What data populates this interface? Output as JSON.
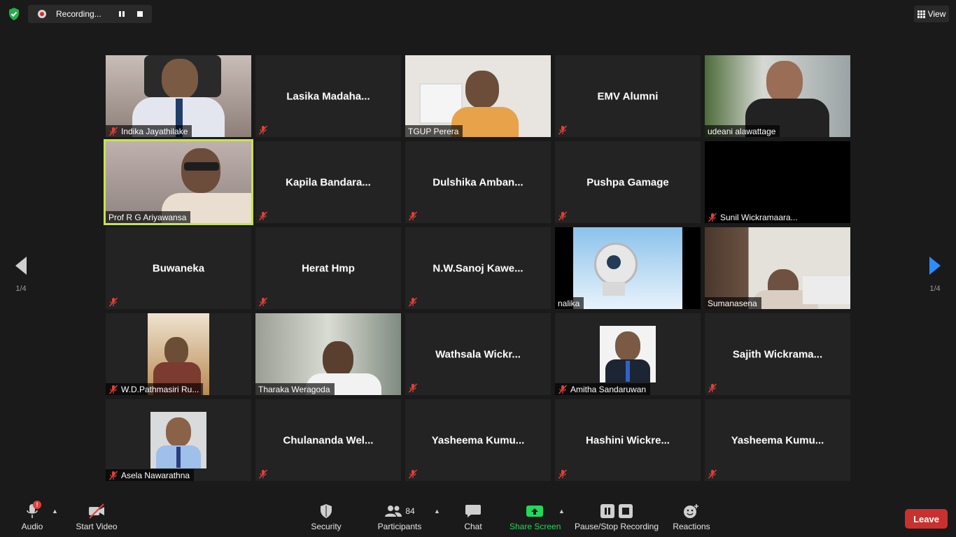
{
  "top": {
    "recording_label": "Recording...",
    "view_label": "View"
  },
  "pages": {
    "left": "1/4",
    "right": "1/4"
  },
  "tiles": [
    {
      "name": "Indika Jayathilake",
      "video": true
    },
    {
      "name": "Lasika  Madaha...",
      "video": false
    },
    {
      "name": "TGUP Perera",
      "video": true
    },
    {
      "name": "EMV Alumni",
      "video": false
    },
    {
      "name": "udeani alawattage",
      "video": true
    },
    {
      "name": "Prof R G Ariyawansa",
      "video": true,
      "active": true
    },
    {
      "name": "Kapila  Bandara...",
      "video": false
    },
    {
      "name": "Dulshika  Amban...",
      "video": false
    },
    {
      "name": "Pushpa Gamage",
      "video": false
    },
    {
      "name": "Sunil Wickramaara...",
      "video": true
    },
    {
      "name": "Buwaneka",
      "video": false
    },
    {
      "name": "Herat Hmp",
      "video": false
    },
    {
      "name": "N.W.Sanoj  Kawe...",
      "video": false
    },
    {
      "name": "nalika",
      "video": true
    },
    {
      "name": "Sumanasena",
      "video": true
    },
    {
      "name": "W.D.Pathmasiri Ru...",
      "video": true
    },
    {
      "name": "Tharaka Weragoda",
      "video": true
    },
    {
      "name": "Wathsala  Wickr...",
      "video": false
    },
    {
      "name": "Amitha Sandaruwan",
      "video": true
    },
    {
      "name": "Sajith  Wickrama...",
      "video": false
    },
    {
      "name": "Asela Nawarathna",
      "video": true
    },
    {
      "name": "Chulananda  Wel...",
      "video": false
    },
    {
      "name": "Yasheema  Kumu...",
      "video": false
    },
    {
      "name": "Hashini  Wickre...",
      "video": false
    },
    {
      "name": "Yasheema  Kumu...",
      "video": false
    }
  ],
  "toolbar": {
    "audio": "Audio",
    "audio_badge": "!",
    "start_video": "Start Video",
    "security": "Security",
    "participants": "Participants",
    "participants_count": "84",
    "chat": "Chat",
    "share_screen": "Share Screen",
    "pause_stop": "Pause/Stop Recording",
    "reactions": "Reactions",
    "leave": "Leave"
  },
  "colors": {
    "active_speaker": "#c6e352",
    "share_green": "#23d959",
    "leave_red": "#c8312e",
    "muted_red": "#e0403a",
    "nav_blue": "#2d8cff"
  }
}
